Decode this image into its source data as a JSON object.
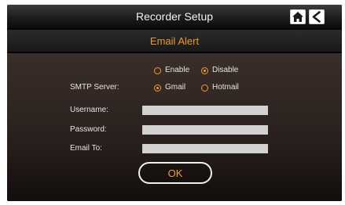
{
  "header": {
    "title": "Recorder Setup"
  },
  "nav": {
    "home_icon": "home-icon",
    "back_icon": "back-arrow-icon"
  },
  "section": {
    "title": "Email Alert"
  },
  "alert": {
    "options": [
      {
        "label": "Enable",
        "selected": false
      },
      {
        "label": "Disable",
        "selected": true
      }
    ]
  },
  "smtp": {
    "label": "SMTP Server:",
    "options": [
      {
        "label": "Gmail",
        "selected": true
      },
      {
        "label": "Hotmail",
        "selected": false
      }
    ]
  },
  "fields": {
    "username": {
      "label": "Username:",
      "value": ""
    },
    "password": {
      "label": "Password:",
      "value": ""
    },
    "email_to": {
      "label": "Email To:",
      "value": ""
    }
  },
  "buttons": {
    "ok": "OK"
  },
  "colors": {
    "accent": "#f0a020",
    "title_text": "#f2f2f2",
    "field_bg": "#d2d2d2",
    "panel_top": "#3a2e2a",
    "panel_bottom": "#120e0c"
  }
}
